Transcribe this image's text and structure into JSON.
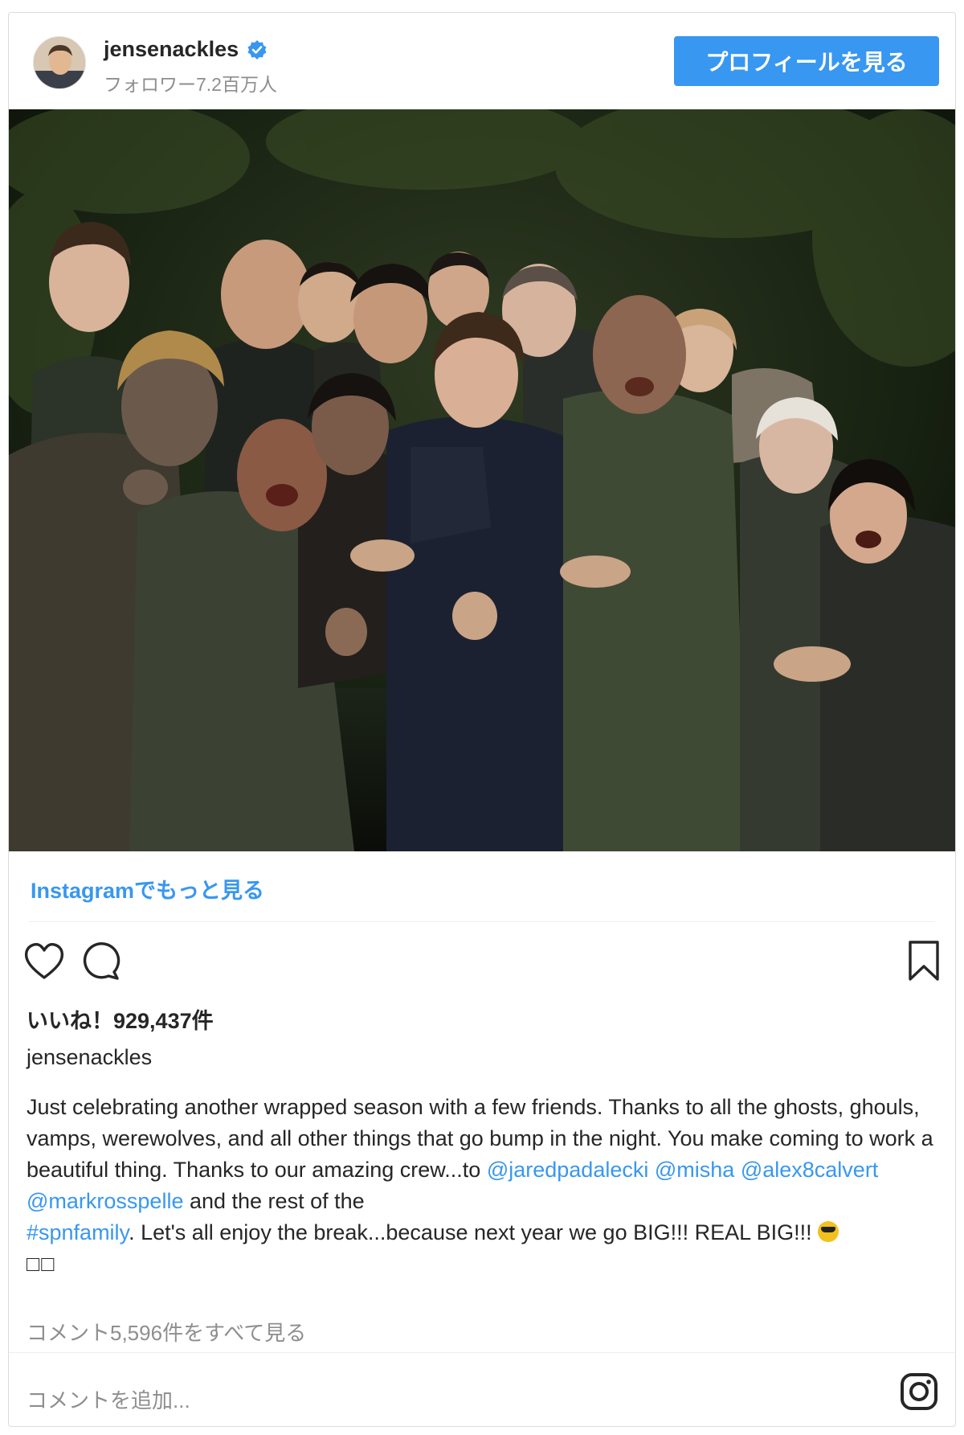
{
  "header": {
    "username": "jensenackles",
    "followers": "フォロワー7.2百万人",
    "profile_button": "プロフィールを見る"
  },
  "photo": {
    "alt": "group photo"
  },
  "more_link": "Instagramでもっと見る",
  "likes": "いいね！929,437件",
  "caption": {
    "username": "jensenackles",
    "text_1": "Just celebrating another wrapped season with a few friends. Thanks to all the ghosts, ghouls, vamps, werewolves, and all other things that go bump in the night. You make coming to work a beautiful thing. Thanks to our amazing crew...to ",
    "mentions": [
      "@jaredpadalecki",
      "@misha",
      "@alex8calvert",
      "@markrosspelle"
    ],
    "text_2": " and the rest of the ",
    "hashtag": "#spnfamily",
    "text_3": ". Let's all enjoy the break...because next year we go BIG!!! REAL BIG!!! ",
    "boxes": "□□"
  },
  "view_comments": "コメント5,596件をすべて見る",
  "add_comment_placeholder": "コメントを追加...",
  "colors": {
    "accent": "#3897f0",
    "text": "#262626",
    "muted": "#8e8e8e"
  }
}
